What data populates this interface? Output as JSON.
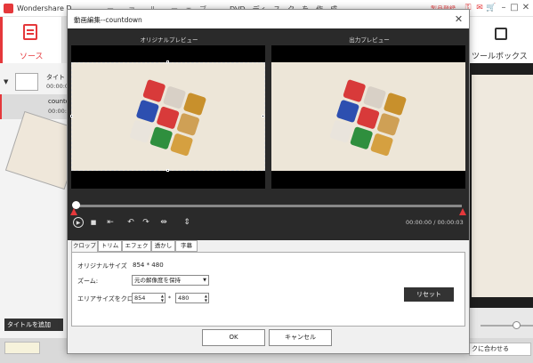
{
  "app": {
    "title": "Wondershare D...",
    "title_middle": "ー　　ァ　　ル　　ー　ェ　ブ",
    "title_right": "DVD　ディ　ス　ク　を　作　成",
    "register_label": "製品登録",
    "icons": [
      "key-icon",
      "mail-icon",
      "cart-icon"
    ],
    "window_controls": [
      "–",
      "□",
      "✕"
    ]
  },
  "sidebar": {
    "source_tab_label": "ソース",
    "items": [
      {
        "name": "タイト",
        "time": "00:00:0"
      },
      {
        "name": "countd",
        "time": "00:00:0"
      }
    ],
    "add_title_button": "タイトルを追加"
  },
  "right_panel": {
    "toolbox_label": "ツールボックス",
    "fit_select_value": "クに合わせる"
  },
  "dialog": {
    "title": "動画編集--countdown",
    "close_symbol": "✕",
    "original_preview_label": "オリジナルプレビュー",
    "output_preview_label": "出力プレビュー",
    "time_readout": "00:00:00 / 00:00:03",
    "playback_progress": 0.0,
    "controls": {
      "play_symbol": "▶",
      "stop_symbol": "■",
      "crop_symbol": "⇤",
      "rotate_left_symbol": "↶",
      "rotate_right_symbol": "↷",
      "flip_h_symbol": "⇹",
      "flip_v_symbol": "⇕"
    },
    "tabs": [
      "クロップ",
      "トリム",
      "エフェクト",
      "透かし",
      "字幕"
    ],
    "active_tab": "クロップ",
    "crop": {
      "original_size_label": "オリジナルサイズ",
      "original_size_value": "854 * 480",
      "zoom_label": "ズーム:",
      "zoom_value": "元の解像度を保持",
      "area_label": "エリアサイズをクロップ:",
      "width_value": "854",
      "height_value": "480",
      "separator": "*",
      "reset_button": "リセット"
    },
    "ok_button": "OK",
    "cancel_button": "キャンセル"
  },
  "colors": {
    "accent": "#e5383b",
    "dark_bg": "#2a2a2a",
    "frame_bg": "#ede6d8"
  }
}
